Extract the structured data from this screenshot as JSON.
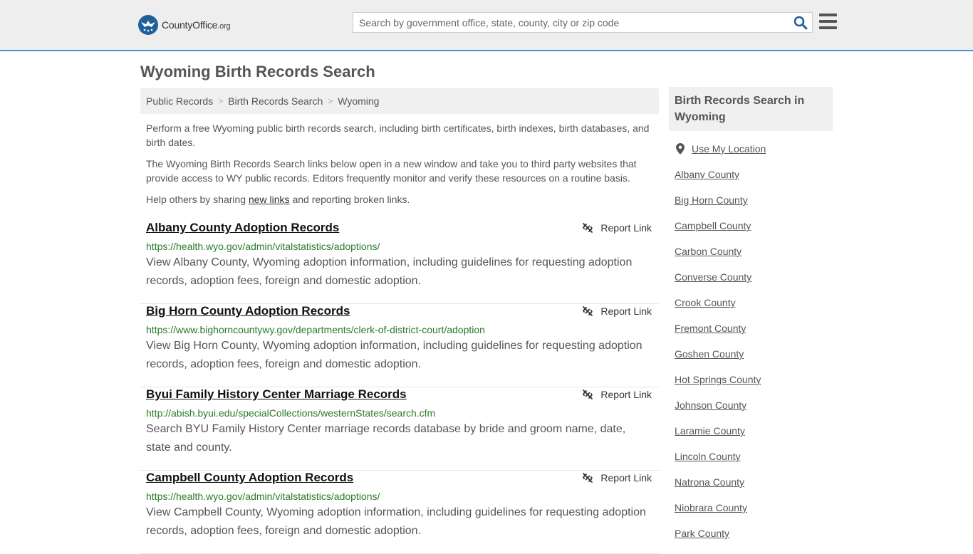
{
  "header": {
    "logo_main": "CountyOffice",
    "logo_suffix": ".org",
    "search_placeholder": "Search by government office, state, county, city or zip code"
  },
  "page_title": "Wyoming Birth Records Search",
  "breadcrumb": [
    "Public Records",
    "Birth Records Search",
    "Wyoming"
  ],
  "intro": {
    "p1": "Perform a free Wyoming public birth records search, including birth certificates, birth indexes, birth databases, and birth dates.",
    "p2": "The Wyoming Birth Records Search links below open in a new window and take you to third party websites that provide access to WY public records. Editors frequently monitor and verify these resources on a routine basis.",
    "p3_before": "Help others by sharing ",
    "p3_link": "new links",
    "p3_after": " and reporting broken links."
  },
  "report_label": "Report Link",
  "records": [
    {
      "title": "Albany County Adoption Records",
      "url": "https://health.wyo.gov/admin/vitalstatistics/adoptions/",
      "desc": "View Albany County, Wyoming adoption information, including guidelines for requesting adoption records, adoption fees, foreign and domestic adoption."
    },
    {
      "title": "Big Horn County Adoption Records",
      "url": "https://www.bighorncountywy.gov/departments/clerk-of-district-court/adoption",
      "desc": "View Big Horn County, Wyoming adoption information, including guidelines for requesting adoption records, adoption fees, foreign and domestic adoption."
    },
    {
      "title": "Byui Family History Center Marriage Records",
      "url": "http://abish.byui.edu/specialCollections/westernStates/search.cfm",
      "desc": "Search BYU Family History Center marriage records database by bride and groom name, date, state and county."
    },
    {
      "title": "Campbell County Adoption Records",
      "url": "https://health.wyo.gov/admin/vitalstatistics/adoptions/",
      "desc": "View Campbell County, Wyoming adoption information, including guidelines for requesting adoption records, adoption fees, foreign and domestic adoption."
    }
  ],
  "sidebar": {
    "heading": "Birth Records Search in Wyoming",
    "use_location": "Use My Location",
    "counties": [
      "Albany County",
      "Big Horn County",
      "Campbell County",
      "Carbon County",
      "Converse County",
      "Crook County",
      "Fremont County",
      "Goshen County",
      "Hot Springs County",
      "Johnson County",
      "Laramie County",
      "Lincoln County",
      "Natrona County",
      "Niobrara County",
      "Park County"
    ]
  }
}
